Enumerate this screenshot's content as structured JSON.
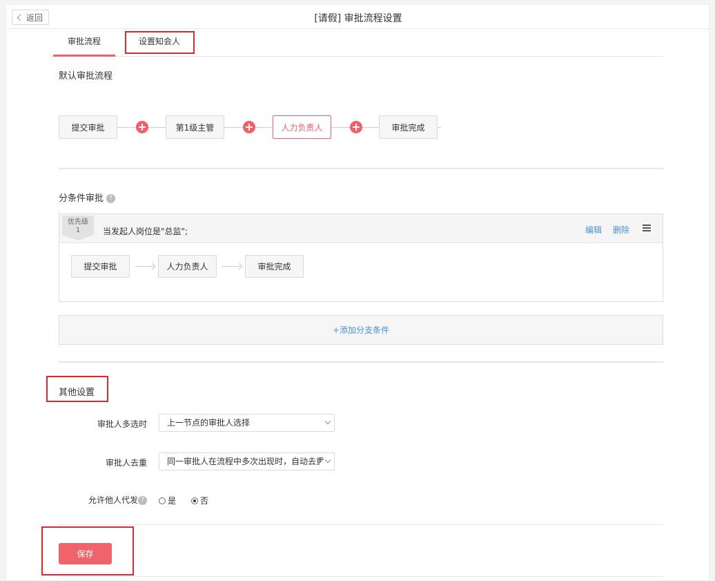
{
  "header": {
    "back_label": "返回",
    "title": "[请假] 审批流程设置"
  },
  "tabs": [
    {
      "label": "审批流程",
      "active": true
    },
    {
      "label": "设置知会人",
      "active": false
    }
  ],
  "default_flow": {
    "title": "默认审批流程",
    "nodes": [
      "提交审批",
      "第1级主管",
      "人力负责人",
      "审批完成"
    ],
    "active_node": "人力负责人"
  },
  "conditional": {
    "title": "分条件审批",
    "help_icon": "question-circle-icon",
    "rules": [
      {
        "priority_label": "优先级",
        "priority": "1",
        "condition": "当发起人岗位是\"总监\";",
        "edit_label": "编辑",
        "delete_label": "删除",
        "nodes": [
          "提交审批",
          "人力负责人",
          "审批完成"
        ]
      }
    ],
    "add_branch_label": "+添加分支条件"
  },
  "other_settings": {
    "title": "其他设置",
    "multi_approver": {
      "label": "审批人多选时",
      "value": "上一节点的审批人选择"
    },
    "dedupe": {
      "label": "审批人去重",
      "value": "同一审批人在流程中多次出现时，自动去重"
    },
    "allow_others": {
      "label": "允许他人代发",
      "options": [
        {
          "label": "是",
          "selected": false
        },
        {
          "label": "否",
          "selected": true
        }
      ]
    }
  },
  "save_label": "保存",
  "colors": {
    "accent": "#f25f68",
    "link": "#4a90d9",
    "highlight_box": "#e0272b"
  }
}
